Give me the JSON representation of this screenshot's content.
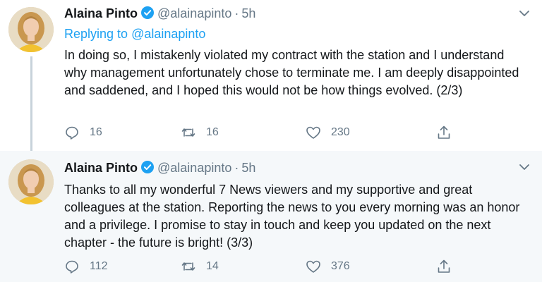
{
  "tweets": [
    {
      "name": "Alaina Pinto",
      "handle": "@alainapinto",
      "dot": "·",
      "time": "5h",
      "reply_prefix": "Replying to ",
      "reply_to": "@alainapinto",
      "text": "In doing so, I mistakenly violated my contract with the station and I understand why management unfortunately chose to terminate me. I am deeply disappointed and saddened, and I hoped this would not be how things evolved. (2/3)",
      "replies": "16",
      "retweets": "16",
      "likes": "230"
    },
    {
      "name": "Alaina Pinto",
      "handle": "@alainapinto",
      "dot": "·",
      "time": "5h",
      "text": "Thanks to all my wonderful 7 News viewers and my supportive and great colleagues at the station. Reporting the news to you every morning was an honor and a privilege. I promise to stay in touch and keep you updated on the next chapter - the future is bright! (3/3)",
      "replies": "112",
      "retweets": "14",
      "likes": "376"
    }
  ],
  "colors": {
    "accent": "#1da1f2",
    "muted": "#657786",
    "highlight_bg": "#f5f8fa"
  }
}
